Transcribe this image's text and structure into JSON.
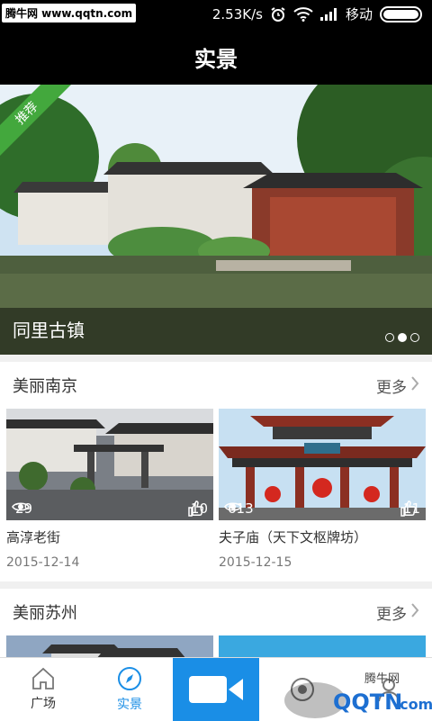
{
  "status": {
    "watermark": "腾牛网 www.qqtn.com",
    "speed": "2.53K/s",
    "carrier": "移动"
  },
  "header": {
    "title": "实景"
  },
  "banner": {
    "badge": "推荐",
    "caption": "同里古镇",
    "page_count": 3,
    "active_page": 2
  },
  "sections": [
    {
      "title": "美丽南京",
      "more": "更多",
      "items": [
        {
          "title": "高淳老街",
          "date": "2015-12-14",
          "views": "29",
          "likes": "10"
        },
        {
          "title": "夫子庙（天下文枢牌坊）",
          "date": "2015-12-15",
          "views": "613",
          "likes": "11"
        }
      ]
    },
    {
      "title": "美丽苏州",
      "more": "更多"
    }
  ],
  "tabs": [
    {
      "label": "广场",
      "icon": "home-icon"
    },
    {
      "label": "实景",
      "icon": "compass-icon"
    },
    {
      "label": "",
      "icon": "video-camera-icon"
    },
    {
      "label": "",
      "icon": "target-icon"
    },
    {
      "label": "",
      "icon": "user-icon"
    }
  ],
  "corner_watermark": "腾牛网 QQTN.com",
  "colors": {
    "accent": "#1a8ee6",
    "badge": "#43a83d",
    "header": "#000000"
  }
}
